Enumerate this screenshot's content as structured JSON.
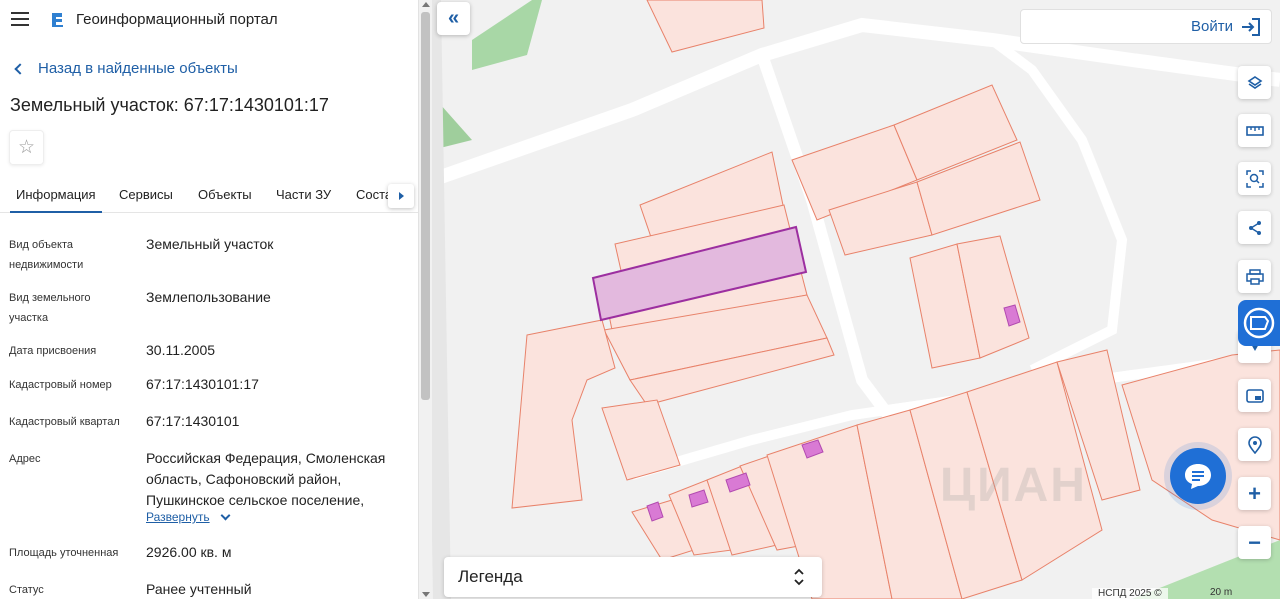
{
  "app": {
    "title": "Геоинформационный портал"
  },
  "nav": {
    "back_label": "Назад в найденные объекты"
  },
  "object": {
    "title": "Земельный участок: 67:17:1430101:17",
    "favorite_icon": "star-icon"
  },
  "tabs": [
    {
      "label": "Информация",
      "active": true
    },
    {
      "label": "Сервисы",
      "active": false
    },
    {
      "label": "Объекты",
      "active": false
    },
    {
      "label": "Части ЗУ",
      "active": false
    },
    {
      "label": "Соста",
      "active": false
    }
  ],
  "properties": [
    {
      "label": "Вид объекта недвижимости",
      "value": "Земельный участок"
    },
    {
      "label": "Вид земельного участка",
      "value": "Землепользование"
    },
    {
      "label": "Дата присвоения",
      "value": "30.11.2005"
    },
    {
      "label": "Кадастровый номер",
      "value": "67:17:1430101:17"
    },
    {
      "label": "Кадастровый квартал",
      "value": "67:17:1430101"
    },
    {
      "label": "Адрес",
      "value": "Российская Федерация, Смоленская область, Сафоновский район, Пушкинское сельское поселение,"
    },
    {
      "label": "Площадь уточненная",
      "value": "2926.00 кв. м"
    },
    {
      "label": "Статус",
      "value": "Ранее учтенный"
    }
  ],
  "expand_label": "Развернуть",
  "map": {
    "login_label": "Войти",
    "legend_label": "Легенда",
    "zoom_in": "+",
    "zoom_out": "−",
    "collapse_label": "«",
    "attribution": "НСПД 2025 ©",
    "scale": "20 m",
    "watermark": "ЦИАН",
    "tools": [
      "layers-icon",
      "ruler-icon",
      "search-area-icon",
      "share-icon",
      "print-icon",
      "location-icon",
      "map-view-icon",
      "geolocation-icon"
    ]
  },
  "colors": {
    "accent": "#1f5fa6",
    "parcel_stroke": "#e8826a",
    "parcel_fill": "#fbe3dd",
    "selected_stroke": "#9c2fa0",
    "selected_fill": "#e3b9de",
    "building_fill": "#d97ad4"
  }
}
